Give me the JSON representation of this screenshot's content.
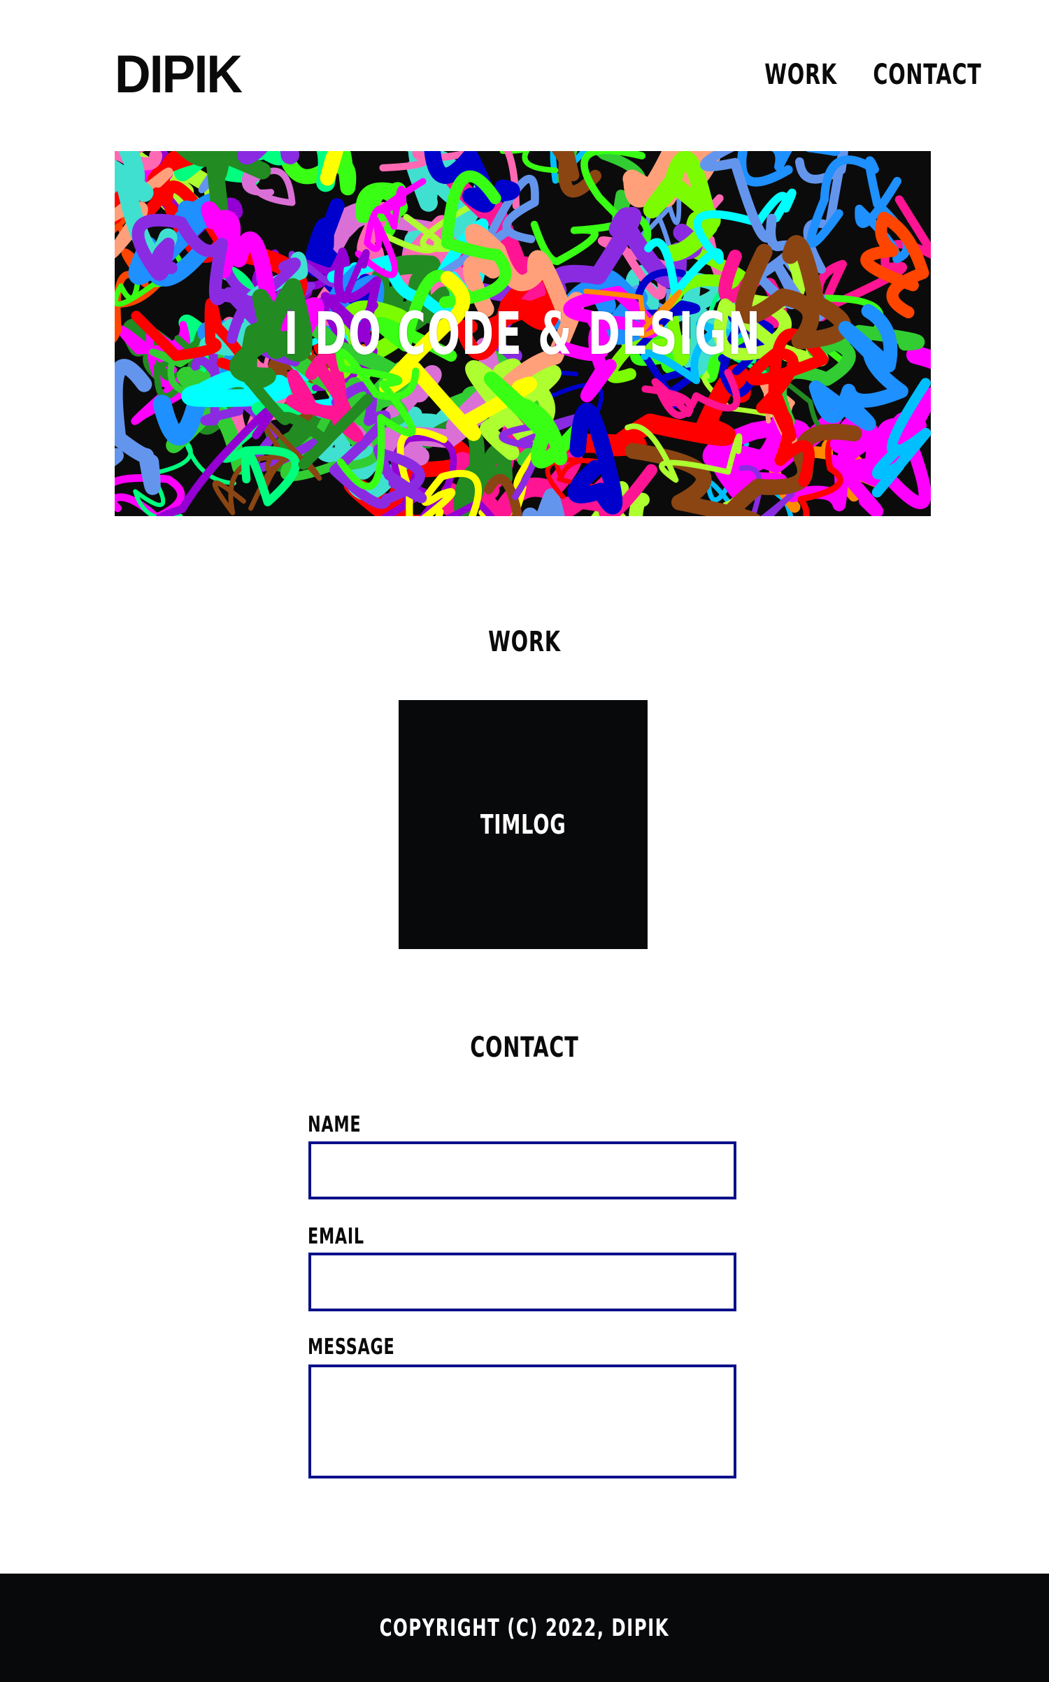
{
  "header": {
    "logo": "DIPIK",
    "nav": [
      {
        "label": "WORK"
      },
      {
        "label": "CONTACT"
      }
    ]
  },
  "hero": {
    "title": "I DO CODE & DESIGN"
  },
  "work": {
    "heading": "WORK",
    "items": [
      {
        "label": "TIMLOG"
      }
    ]
  },
  "contact": {
    "heading": "CONTACT",
    "fields": {
      "name_label": "NAME",
      "name_value": "",
      "email_label": "EMAIL",
      "email_value": "",
      "message_label": "MESSAGE",
      "message_value": ""
    }
  },
  "footer": {
    "copyright": "COPYRIGHT (C) 2022, DIPIK"
  },
  "colors": {
    "text": "#0a0a0a",
    "background": "#ffffff",
    "dark": "#08090b",
    "input_border": "#0b0f8a"
  }
}
